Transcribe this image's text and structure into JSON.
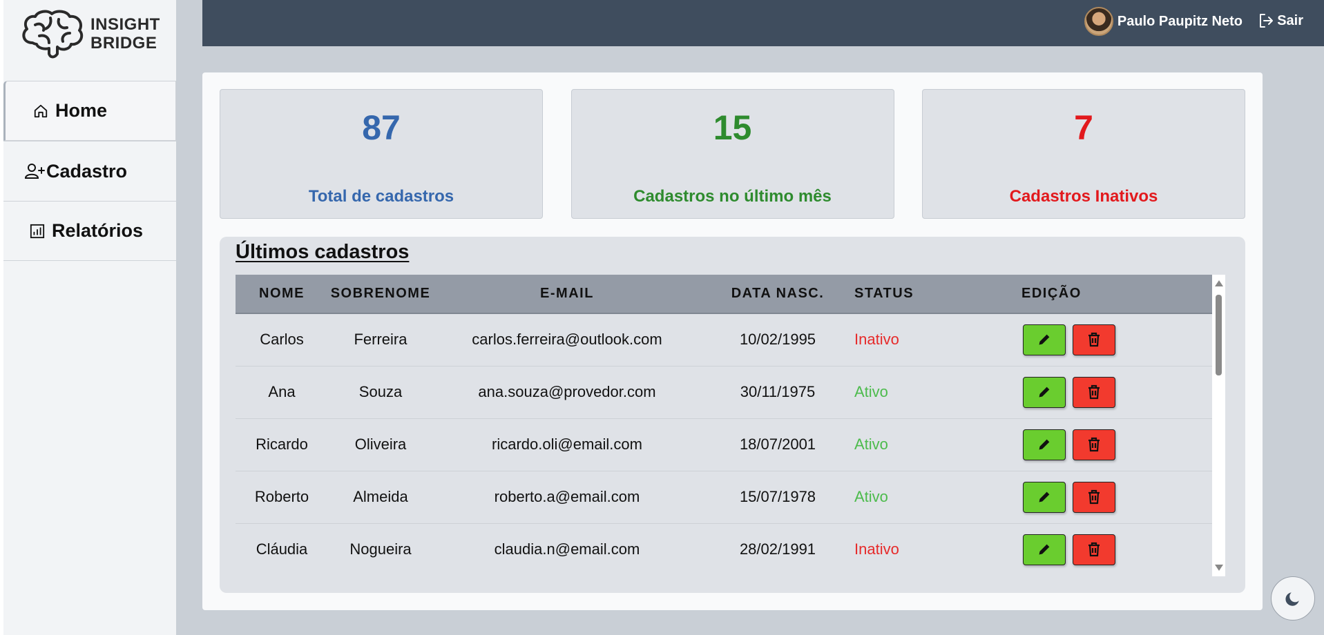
{
  "brand": {
    "line1": "INSIGHT",
    "line2": "BRIDGE"
  },
  "sidebar": {
    "items": [
      {
        "label": "Home",
        "icon": "home-icon"
      },
      {
        "label": "Cadastro",
        "icon": "user-plus-icon"
      },
      {
        "label": "Relatórios",
        "icon": "report-icon"
      }
    ]
  },
  "header": {
    "user_name": "Paulo Paupitz Neto",
    "logout_label": "Sair"
  },
  "stats": [
    {
      "value": "87",
      "label": "Total de cadastros",
      "color": "#3567ad"
    },
    {
      "value": "15",
      "label": "Cadastros no último mês",
      "color": "#2e8b2e"
    },
    {
      "value": "7",
      "label": "Cadastros Inativos",
      "color": "#e2191d"
    }
  ],
  "table": {
    "title": "Últimos cadastros",
    "columns": [
      "NOME",
      "SOBRENOME",
      "E-MAIL",
      "DATA NASC.",
      "STATUS",
      "EDIÇÃO"
    ],
    "rows": [
      {
        "nome": "Carlos",
        "sobrenome": "Ferreira",
        "email": "carlos.ferreira@outlook.com",
        "data": "10/02/1995",
        "status": "Inativo"
      },
      {
        "nome": "Ana",
        "sobrenome": "Souza",
        "email": "ana.souza@provedor.com",
        "data": "30/11/1975",
        "status": "Ativo"
      },
      {
        "nome": "Ricardo",
        "sobrenome": "Oliveira",
        "email": "ricardo.oli@email.com",
        "data": "18/07/2001",
        "status": "Ativo"
      },
      {
        "nome": "Roberto",
        "sobrenome": "Almeida",
        "email": "roberto.a@email.com",
        "data": "15/07/1978",
        "status": "Ativo"
      },
      {
        "nome": "Cláudia",
        "sobrenome": "Nogueira",
        "email": "claudia.n@email.com",
        "data": "28/02/1991",
        "status": "Inativo"
      }
    ]
  },
  "theme_toggle": {
    "icon": "moon-icon"
  }
}
